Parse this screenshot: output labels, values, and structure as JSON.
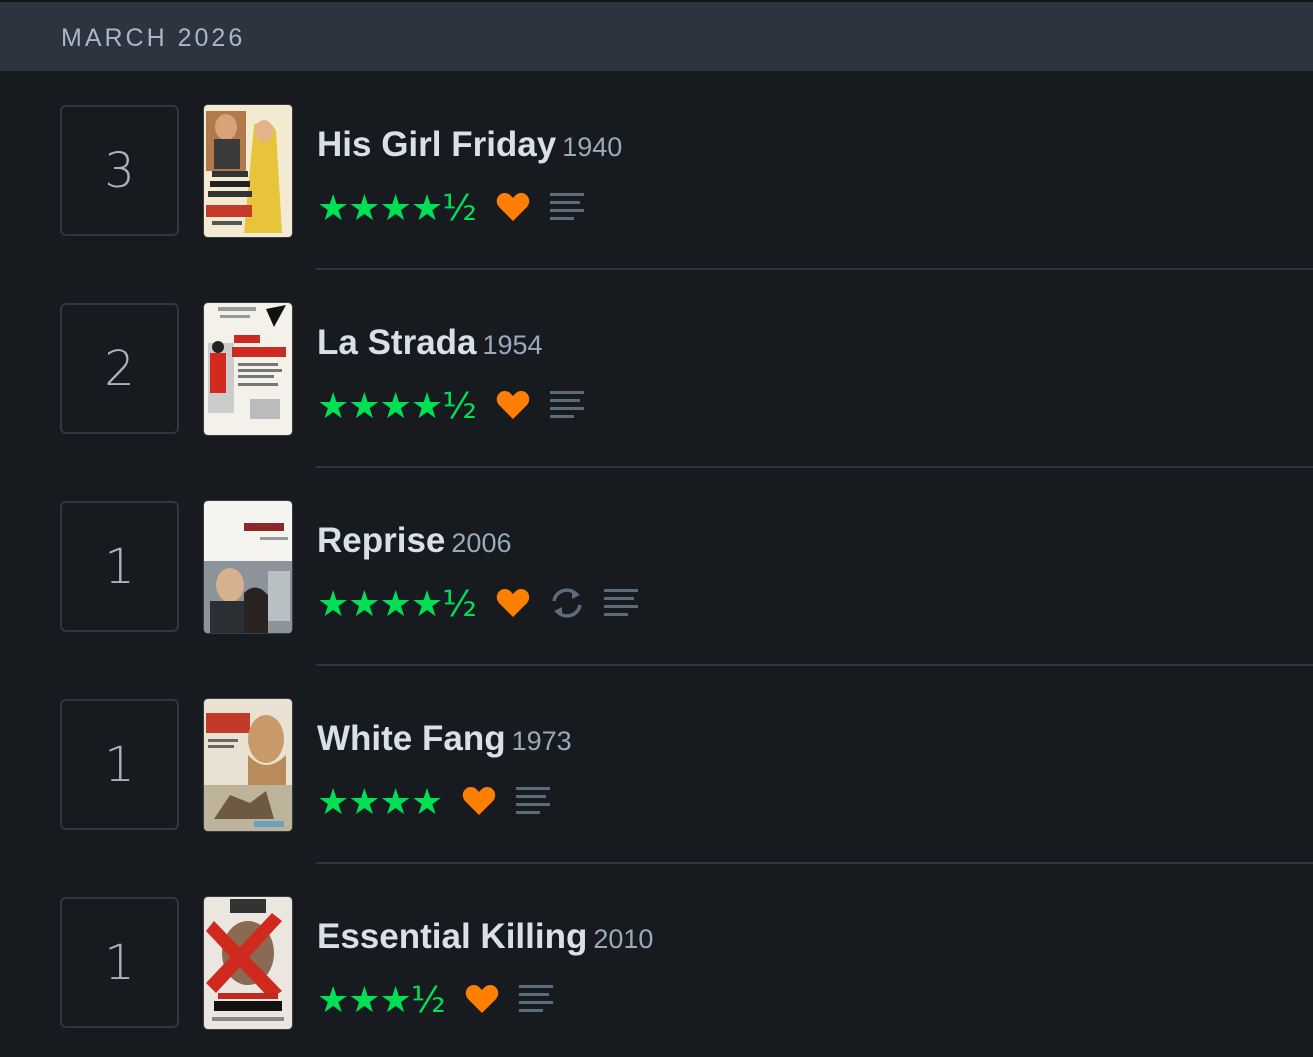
{
  "month_label": "MARCH 2026",
  "colors": {
    "star": "#00e054",
    "heart": "#ff8000",
    "icon_muted": "#5c6b7a",
    "header_bg": "#2c3440",
    "page_bg": "#171b20"
  },
  "entries": [
    {
      "day": "3",
      "title": "His Girl Friday",
      "year": "1940",
      "stars": "★★★★½",
      "rating": 4.5,
      "liked": true,
      "rewatch": false,
      "has_review": true,
      "poster_icon": "his-girl-friday-poster"
    },
    {
      "day": "2",
      "title": "La Strada",
      "year": "1954",
      "stars": "★★★★½",
      "rating": 4.5,
      "liked": true,
      "rewatch": false,
      "has_review": true,
      "poster_icon": "la-strada-poster"
    },
    {
      "day": "1",
      "title": "Reprise",
      "year": "2006",
      "stars": "★★★★½",
      "rating": 4.5,
      "liked": true,
      "rewatch": true,
      "has_review": true,
      "poster_icon": "reprise-poster"
    },
    {
      "day": "1",
      "title": "White Fang",
      "year": "1973",
      "stars": "★★★★",
      "rating": 4,
      "liked": true,
      "rewatch": false,
      "has_review": true,
      "poster_icon": "white-fang-poster"
    },
    {
      "day": "1",
      "title": "Essential Killing",
      "year": "2010",
      "stars": "★★★½",
      "rating": 3.5,
      "liked": true,
      "rewatch": false,
      "has_review": true,
      "poster_icon": "essential-killing-poster"
    }
  ]
}
